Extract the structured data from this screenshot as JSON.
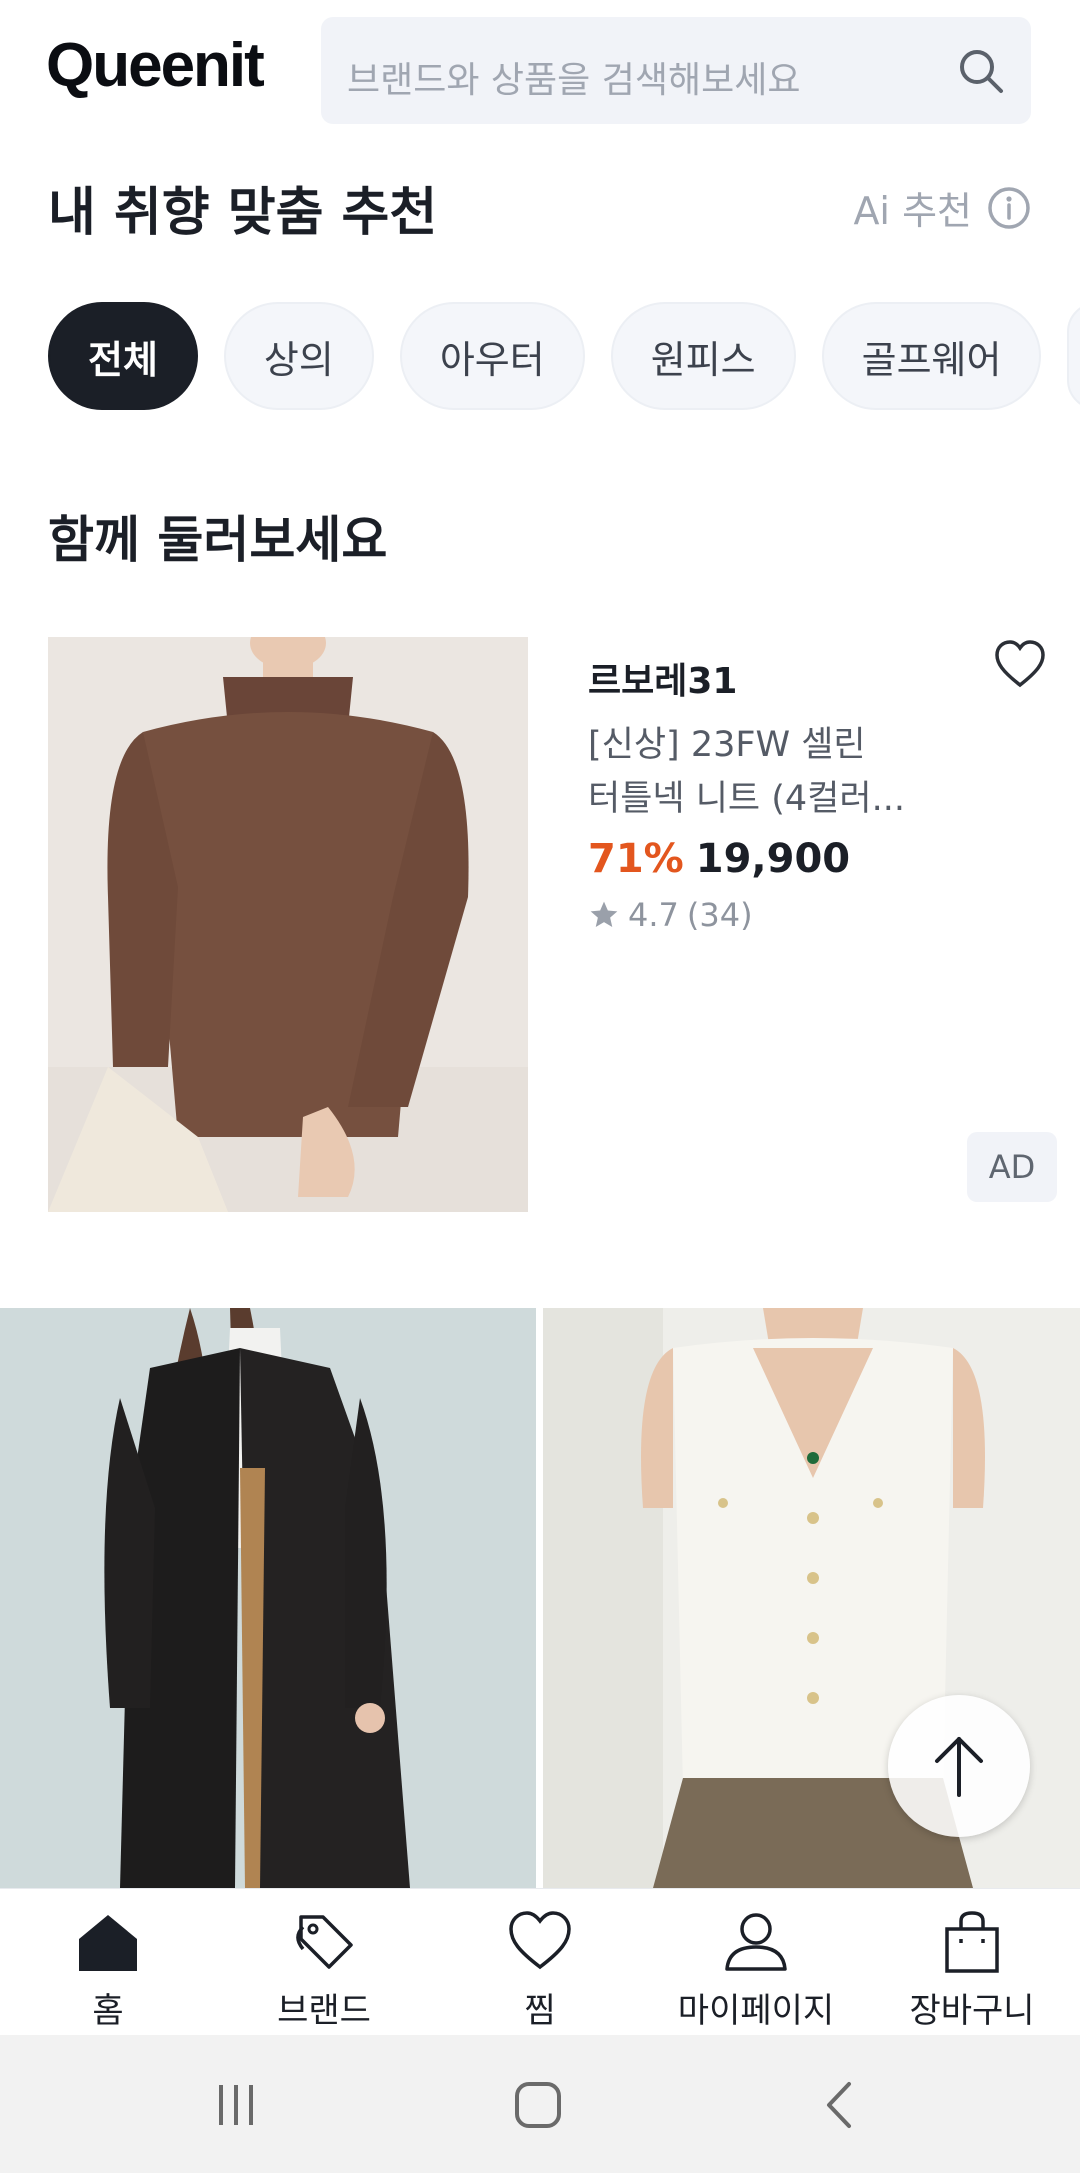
{
  "header": {
    "logo": "Queenit",
    "search_placeholder": "브랜드와 상품을 검색해보세요"
  },
  "recommend": {
    "title": "내 취향 맞춤 추천",
    "ai_label": "Ai 추천",
    "chips": [
      "전체",
      "상의",
      "아우터",
      "원피스",
      "골프웨어"
    ],
    "active_chip": "전체"
  },
  "browse": {
    "title": "함께 둘러보세요",
    "ad_product": {
      "brand": "르보레31",
      "name_line1": "[신상] 23FW 셀린",
      "name_line2": "터틀넥 니트 (4컬러...",
      "discount": "71%",
      "price": "19,900",
      "rating": "4.7",
      "reviews": "(34)",
      "badge": "AD"
    }
  },
  "bottom_nav": {
    "items": [
      {
        "label": "홈",
        "icon": "home-icon"
      },
      {
        "label": "브랜드",
        "icon": "tag-icon"
      },
      {
        "label": "찜",
        "icon": "heart-icon"
      },
      {
        "label": "마이페이지",
        "icon": "user-icon"
      },
      {
        "label": "장바구니",
        "icon": "bag-icon"
      }
    ]
  },
  "colors": {
    "accent_discount": "#e3561e",
    "chip_active_bg": "#1b1f27",
    "search_bg": "#f1f3f8"
  }
}
